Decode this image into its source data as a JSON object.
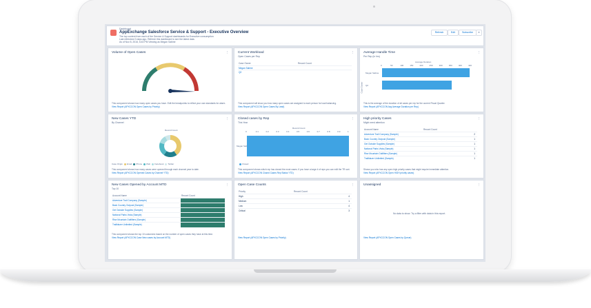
{
  "header": {
    "crumb": "Dashboard",
    "title": "AppExchange Salesforce Service & Support - Executive Overview",
    "desc": "The top content from each of the Service & Support dashboards for Executive consumption",
    "refresh_note": "Last refreshed 3 days ago. Refresh this dashboard to see the latest data.",
    "as_of": "As of Nov 8, 2016, 6:43 PM  Viewing as Megan Sabine",
    "buttons": [
      "Refresh",
      "Edit",
      "Subscribe"
    ],
    "dropdown_icon": "chevron-down-icon"
  },
  "cards": {
    "volume": {
      "title": "Volume of Open Cases",
      "desc": "This component shows how many open cases you have. Edit the breakpoints to reflect your own standards for alarm.",
      "link": "View Report (APXCCON Open Cases by Priority)",
      "gauge_colors": [
        "#2e7d6d",
        "#e8c96d",
        "#c23934"
      ],
      "needle_fraction": 0.4
    },
    "workload": {
      "title": "Current Workload",
      "subtitle": "Open Cases per Rep",
      "headers": [
        "Case Owner",
        "Record Count"
      ],
      "rows": [
        {
          "name": "Megan Sabine",
          "count": ""
        },
        {
          "name": "Q2",
          "count": ""
        }
      ],
      "desc": "This component will show you how many open cases are assigned to each person for load balancing.",
      "link": "View Report (APXCCON Open Cases By Lead)"
    },
    "handle": {
      "title": "Average Handle Time",
      "subtitle": "Per Rep (in hrs)",
      "yaxis": "Case Owner",
      "chart_title": "Average Duration",
      "chart_data": {
        "type": "bar",
        "categories": [
          "Megan Sabine",
          "Q2"
        ],
        "values": [
          420,
          335
        ],
        "xlim": [
          0,
          420
        ],
        "ticks": [
          "0",
          "50",
          "100",
          "150",
          "200",
          "250",
          "300",
          "350",
          "400",
          "420"
        ]
      },
      "desc": "This is the average of the duration of all cases per rep for the current Fiscal Quarter.",
      "link": "View Report (APXCCON Avg Average Duration per Rep)"
    },
    "newcases": {
      "title": "New Cases YTD",
      "subtitle": "By Channel",
      "chart_title": "Record Count",
      "chart_data": {
        "type": "pie",
        "categories": [
          "Email",
          "Phone",
          "Web",
          "Facebook",
          "Twitter"
        ],
        "values": [
          40,
          20,
          20,
          12,
          8
        ],
        "colors": [
          "#e8c96d",
          "#1f7f8c",
          "#51b8c4",
          "#a7dbe0",
          "#d0e8ea"
        ]
      },
      "legend_label": "Case Origin",
      "desc": "This component shows how many cases were opened through each channel year to date.",
      "link": "View Report (APXCCON Opened Cases by Channel YTD)"
    },
    "closed": {
      "title": "Closed cases by Rep",
      "subtitle": "This Year",
      "yaxis": "Case Owner",
      "chart_title": "Record Count",
      "chart_data": {
        "type": "bar",
        "categories": [
          "Megan Sabine"
        ],
        "values": [
          1
        ],
        "xlim": [
          0,
          1
        ],
        "ticks": [
          "0",
          "0.1",
          "0.2",
          "0.3",
          "0.4",
          "0.5",
          "0.6",
          "0.7",
          "0.8",
          "0.9",
          "1"
        ]
      },
      "legend": "Closed",
      "desc": "This component shows which rep has closed the most cases. If you have a large # of reps you can edit the TR sort.",
      "link": "View Report (APXCCON Closed Cases Rep Status YTD)"
    },
    "priority": {
      "title": "High priority Cases",
      "subtitle": "Might need attention",
      "headers": [
        "Account Name",
        "Record Count"
      ],
      "rows": [
        {
          "name": "Adventure Trail Company (Sample)",
          "count": "2"
        },
        {
          "name": "Back Country Outpost (Sample)",
          "count": "1"
        },
        {
          "name": "Get Outside Supplies (Sample)",
          "count": "1"
        },
        {
          "name": "National Parks Vista (Sample)",
          "count": "1"
        },
        {
          "name": "Rise Mountain Outfitters (Sample)",
          "count": "1"
        },
        {
          "name": "Trailblazer Unlimited (Sample)",
          "count": "1"
        }
      ],
      "desc": "Shows you who has any open high priority cases that might require immediate attention.",
      "link": "View Report (APXCCON Open HIGH priority cases)"
    },
    "byaccount": {
      "title": "New Cases Opened by Account MTD",
      "subtitle": "Top 10",
      "headers": [
        "Account Name",
        "Record Count"
      ],
      "rows": [
        {
          "name": "Adventure Trail Company (Sample)"
        },
        {
          "name": "Back Country Outpost (Sample)"
        },
        {
          "name": "Get Outside Supplies (Sample)"
        },
        {
          "name": "National Parks Vista (Sample)"
        },
        {
          "name": "Rise Mountain Outfitters (Sample)"
        },
        {
          "name": "Trailblazer Unlimited (Sample)"
        }
      ],
      "desc": "This component shows the top 10 customers based on the number of open cases they have at this time.",
      "link": "View Report (APXCCON Case New cases by Account MTD)"
    },
    "counts": {
      "title": "Open Case Counts",
      "headers": [
        "Priority",
        "Record Count"
      ],
      "rows": [
        {
          "name": "High",
          "count": "4"
        },
        {
          "name": "Medium",
          "count": "1"
        },
        {
          "name": "Low",
          "count": "4"
        },
        {
          "name": "Critical",
          "count": "3"
        }
      ],
      "link": "View Report (APXCCON Open Cases by Priority)"
    },
    "unassigned": {
      "title": "Unassigned",
      "empty": "No data to show. Try a filter with data in this report.",
      "link": "View Report (APXCCON Open Cases by Queue)"
    }
  }
}
